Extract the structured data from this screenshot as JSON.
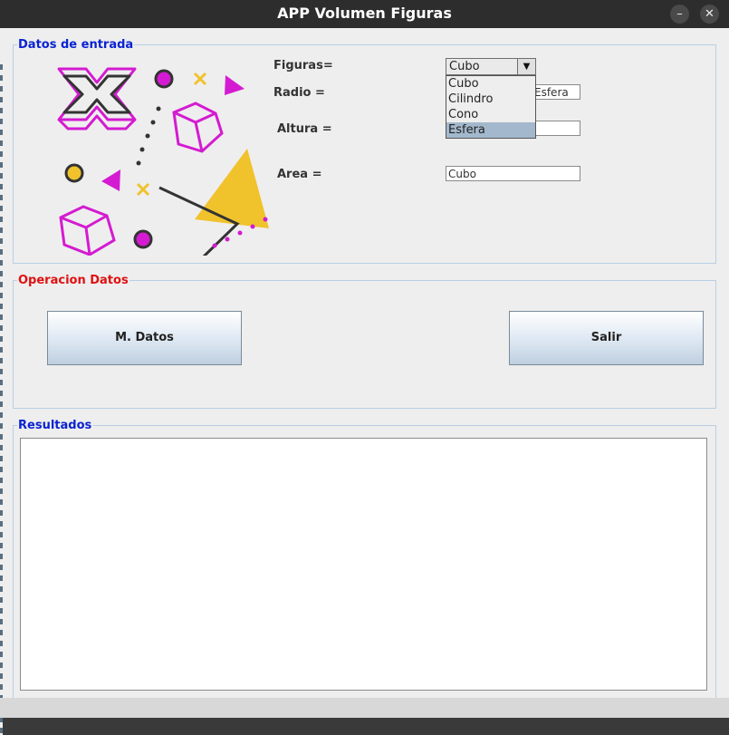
{
  "window": {
    "title": "APP Volumen Figuras",
    "minimize_icon": "–",
    "close_icon": "✕"
  },
  "datos_entrada": {
    "legend": "Datos de entrada",
    "legend_color": "#0a23d1",
    "labels": {
      "figuras": "Figuras=",
      "radio": "Radio =",
      "altura": "Altura =",
      "area": "Area ="
    },
    "combo": {
      "selected": "Cubo",
      "arrow": "▼",
      "options": [
        "Cubo",
        "Cilindro",
        "Cono",
        "Esfera"
      ],
      "highlighted": "Esfera"
    },
    "fields": {
      "radio_value": "Esfera",
      "altura_value": "",
      "area_value": "Cubo"
    }
  },
  "operacion": {
    "legend": "Operacion Datos",
    "legend_color": "#e01010",
    "buttons": {
      "mdatos": "M. Datos",
      "salir": "Salir"
    }
  },
  "resultados": {
    "legend": "Resultados",
    "legend_color": "#0a23d1",
    "text": ""
  },
  "decoration_colors": {
    "magenta": "#d41bd1",
    "yellow": "#f0c22c",
    "dark": "#333333"
  }
}
